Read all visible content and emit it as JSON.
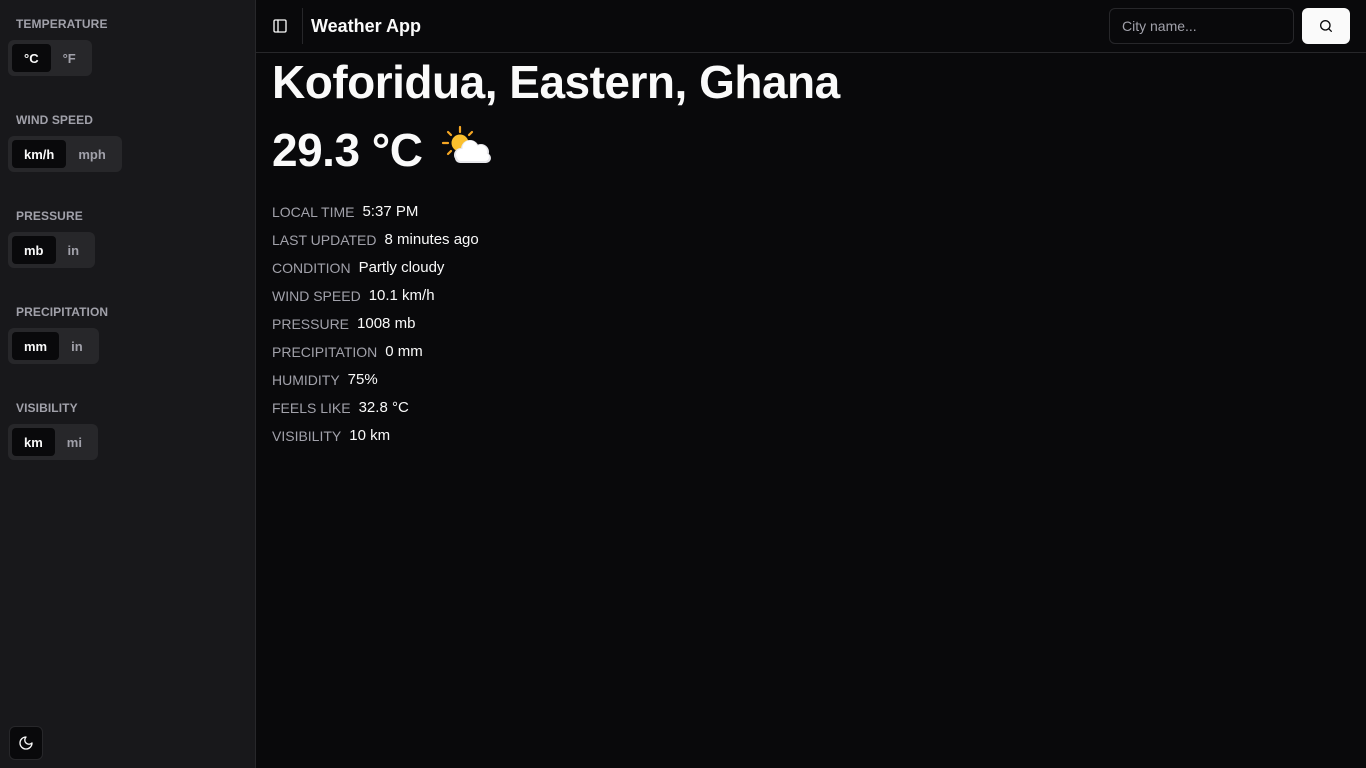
{
  "sidebar": {
    "groups": [
      {
        "label": "TEMPERATURE",
        "options": [
          "°C",
          "°F"
        ],
        "selected": "°C"
      },
      {
        "label": "WIND SPEED",
        "options": [
          "km/h",
          "mph"
        ],
        "selected": "km/h"
      },
      {
        "label": "PRESSURE",
        "options": [
          "mb",
          "in"
        ],
        "selected": "mb"
      },
      {
        "label": "PRECIPITATION",
        "options": [
          "mm",
          "in"
        ],
        "selected": "mm"
      },
      {
        "label": "VISIBILITY",
        "options": [
          "km",
          "mi"
        ],
        "selected": "km"
      }
    ],
    "theme_icon": "moon-icon"
  },
  "header": {
    "sidebar_toggle_icon": "sidebar-toggle-icon",
    "title": "Weather App",
    "search_placeholder": "City name...",
    "search_value": "",
    "search_icon": "search-icon"
  },
  "weather": {
    "location": "Koforidua, Eastern, Ghana",
    "temperature": "29.3 °C",
    "condition_icon": "partly-cloudy-icon",
    "details": [
      {
        "label": "LOCAL TIME",
        "value": "5:37 PM"
      },
      {
        "label": "LAST UPDATED",
        "value": "8 minutes ago"
      },
      {
        "label": "CONDITION",
        "value": "Partly cloudy"
      },
      {
        "label": "WIND SPEED",
        "value": "10.1 km/h"
      },
      {
        "label": "PRESSURE",
        "value": "1008 mb"
      },
      {
        "label": "PRECIPITATION",
        "value": "0 mm"
      },
      {
        "label": "HUMIDITY",
        "value": "75%"
      },
      {
        "label": "FEELS LIKE",
        "value": "32.8 °C"
      },
      {
        "label": "VISIBILITY",
        "value": "10 km"
      }
    ]
  },
  "colors": {
    "background": "#09090b",
    "sidebar": "#18181b",
    "border": "#27272a",
    "muted_text": "#a1a1aa",
    "text": "#fafafa"
  }
}
